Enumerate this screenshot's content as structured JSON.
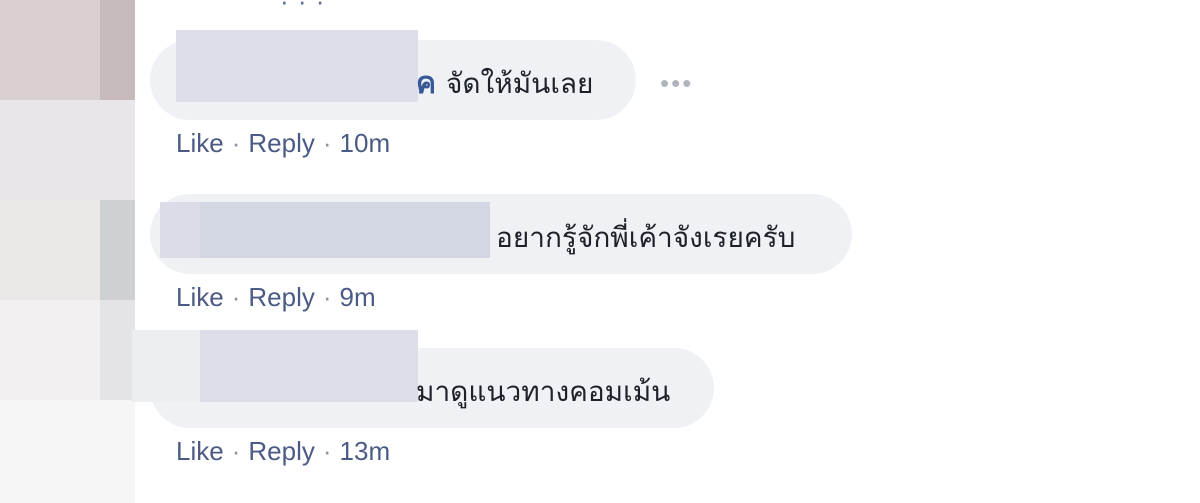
{
  "comments": [
    {
      "author_visible": "ค",
      "text": "จัดให้มันเลย",
      "like_label": "Like",
      "reply_label": "Reply",
      "separator": "·",
      "time": "10m",
      "more_icon": "ellipsis-icon"
    },
    {
      "author_visible": "",
      "text": "อยากรู้จักพี่เค้าจังเรยครับ",
      "like_label": "Like",
      "reply_label": "Reply",
      "separator": "·",
      "time": "9m"
    },
    {
      "author_visible": "",
      "text": "มาดูแนวทางคอมเม้น",
      "like_label": "Like",
      "reply_label": "Reply",
      "separator": "·",
      "time": "13m"
    }
  ],
  "colors": {
    "bubble": "#eff1f5",
    "link": "#4b5b86",
    "text": "#1d2129",
    "author": "#385898"
  }
}
